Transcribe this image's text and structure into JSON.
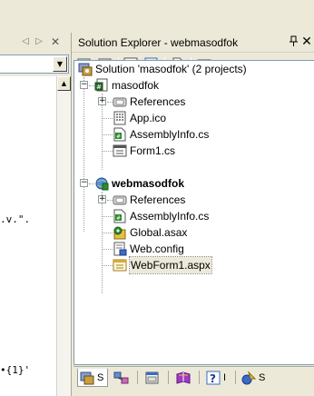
{
  "left_pane": {
    "nav_prev": "◁",
    "nav_next": "▷",
    "nav_close": "✕",
    "combo_arrow": "▼",
    "scroll_up_arrow": "▲",
    "code_line_1": ".v.\".",
    "code_line_2": "•{1}'"
  },
  "solution_explorer": {
    "title": "Solution Explorer - webmasodfok",
    "pin_glyph": "ᵖ",
    "close_glyph": "✕",
    "toolbar_icons": [
      "properties-icon",
      "show-all-files-icon",
      "refresh-icon",
      "copy-project-icon",
      "view-code-icon",
      "view-designer-icon"
    ],
    "tree": {
      "solution_label": "Solution 'masodfok' (2 projects)",
      "project1": {
        "label": "masodfok",
        "items": [
          "References",
          "App.ico",
          "AssemblyInfo.cs",
          "Form1.cs"
        ]
      },
      "project2": {
        "label": "webmasodfok",
        "items": [
          "References",
          "AssemblyInfo.cs",
          "Global.asax",
          "Web.config",
          "WebForm1.aspx"
        ]
      },
      "collapse_glyph": "−",
      "expand_glyph": "+"
    },
    "bottom_tabs": {
      "solution_explorer_short": "S",
      "help_short": "I",
      "dynamic_help_short": "S"
    }
  },
  "colors": {
    "chrome": "#ece9d8",
    "tree_border": "#7f9db9",
    "selection": "#ece9d8"
  }
}
